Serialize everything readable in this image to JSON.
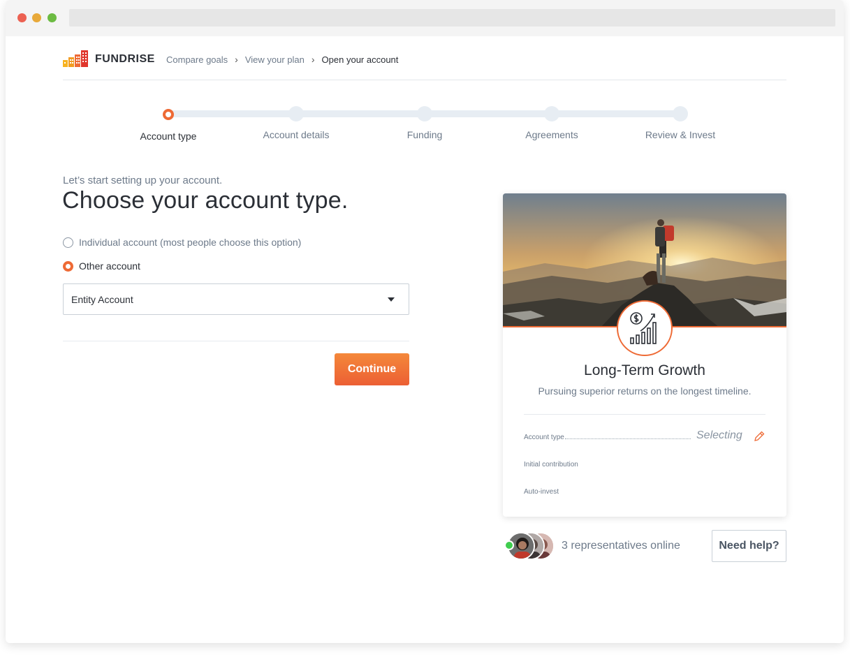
{
  "brand": {
    "name": "FUNDRISE",
    "accent": "#ee6a35"
  },
  "breadcrumb": [
    {
      "label": "Compare goals"
    },
    {
      "label": "View your plan"
    },
    {
      "label": "Open your account"
    }
  ],
  "steps": [
    {
      "label": "Account type",
      "state": "active"
    },
    {
      "label": "Account details",
      "state": "pending"
    },
    {
      "label": "Funding",
      "state": "pending"
    },
    {
      "label": "Agreements",
      "state": "pending"
    },
    {
      "label": "Review & Invest",
      "state": "pending"
    }
  ],
  "form": {
    "subtitle": "Let’s start setting up your account.",
    "title": "Choose your account type.",
    "options": [
      {
        "label": "Individual account (most people choose this option)",
        "checked": false
      },
      {
        "label": "Other account",
        "checked": true
      }
    ],
    "select": {
      "value": "Entity Account"
    },
    "continue_label": "Continue"
  },
  "plan_card": {
    "icon": "growth-chart-icon",
    "title": "Long-Term Growth",
    "description": "Pursuing superior returns on the longest timeline.",
    "rows": [
      {
        "label": "Account type",
        "value": "Selecting"
      },
      {
        "label": "Initial contribution"
      },
      {
        "label": "Auto-invest"
      }
    ]
  },
  "support": {
    "reps_text": "3 representatives online",
    "help_label": "Need help?"
  }
}
